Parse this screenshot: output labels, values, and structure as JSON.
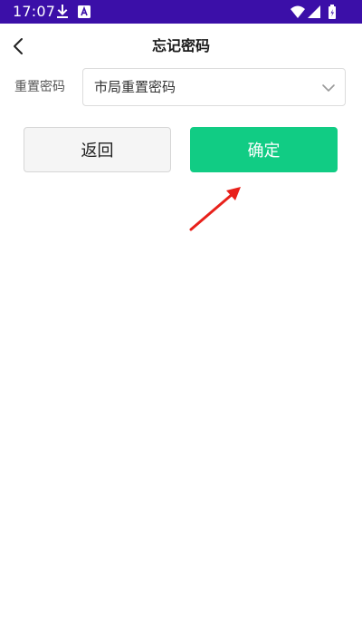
{
  "status_bar": {
    "time": "17:07",
    "background": "#3b0fa8",
    "icons": [
      "download-icon",
      "a-box-icon",
      "wifi-icon",
      "signal-icon",
      "battery-icon"
    ]
  },
  "header": {
    "title": "忘记密码",
    "back_icon": "chevron-left-icon"
  },
  "form": {
    "label": "重置密码",
    "select_value": "市局重置密码",
    "select_icon": "chevron-down-icon"
  },
  "buttons": {
    "back_label": "返回",
    "confirm_label": "确定",
    "confirm_color": "#11cc84"
  },
  "annotation": {
    "arrow_color": "#e8201a"
  }
}
